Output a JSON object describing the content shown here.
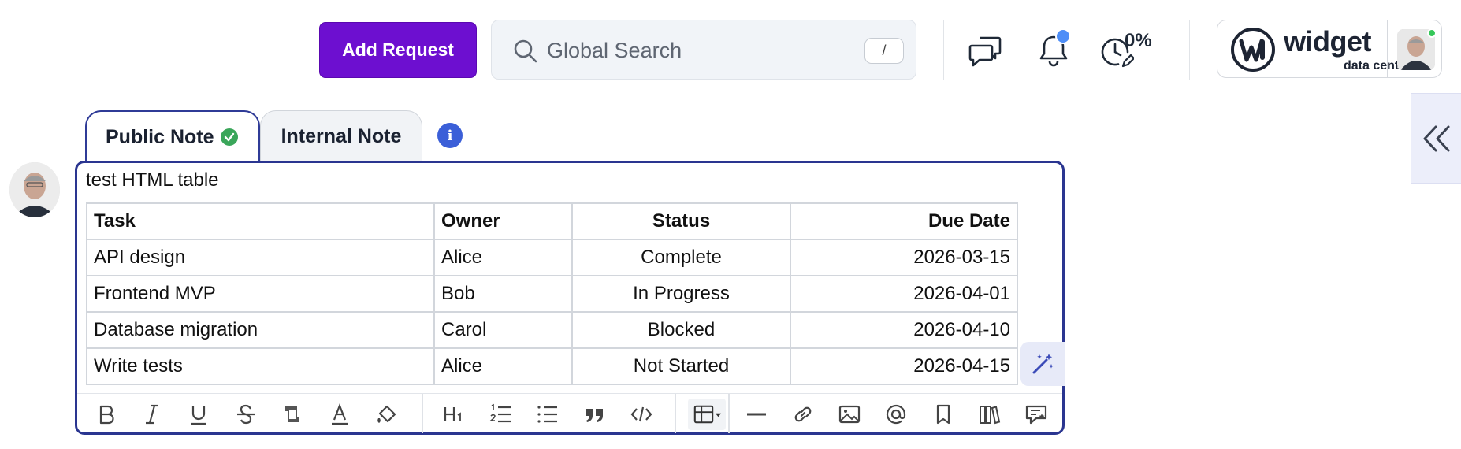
{
  "header": {
    "add_request_label": "Add Request",
    "search_placeholder": "Global Search",
    "search_shortcut": "/",
    "progress_percent": "0%",
    "brand_name": "widget",
    "brand_subtitle": "data center"
  },
  "composer": {
    "tabs": [
      {
        "label": "Public Note",
        "active": true
      },
      {
        "label": "Internal Note",
        "active": false
      }
    ],
    "editor_text": "test HTML table",
    "table": {
      "headers": [
        "Task",
        "Owner",
        "Status",
        "Due Date"
      ],
      "rows": [
        [
          "API design",
          "Alice",
          "Complete",
          "2026-03-15"
        ],
        [
          "Frontend MVP",
          "Bob",
          "In Progress",
          "2026-04-01"
        ],
        [
          "Database migration",
          "Carol",
          "Blocked",
          "2026-04-10"
        ],
        [
          "Write tests",
          "Alice",
          "Not Started",
          "2026-04-15"
        ]
      ]
    },
    "toolbar_icons": [
      "bold-icon",
      "italic-icon",
      "underline-icon",
      "strikethrough-icon",
      "highlight-icon",
      "text-color-icon",
      "paint-bucket-icon",
      "heading-icon",
      "ordered-list-icon",
      "bullet-list-icon",
      "quote-icon",
      "code-icon",
      "table-icon",
      "horizontal-rule-icon",
      "link-icon",
      "image-icon",
      "mention-icon",
      "bookmark-icon",
      "library-icon",
      "canned-response-icon"
    ]
  },
  "colors": {
    "accent_purple": "#6d0fd0",
    "editor_border": "#2a3590",
    "check_green": "#3aa65a",
    "info_blue": "#3b5fd8"
  }
}
